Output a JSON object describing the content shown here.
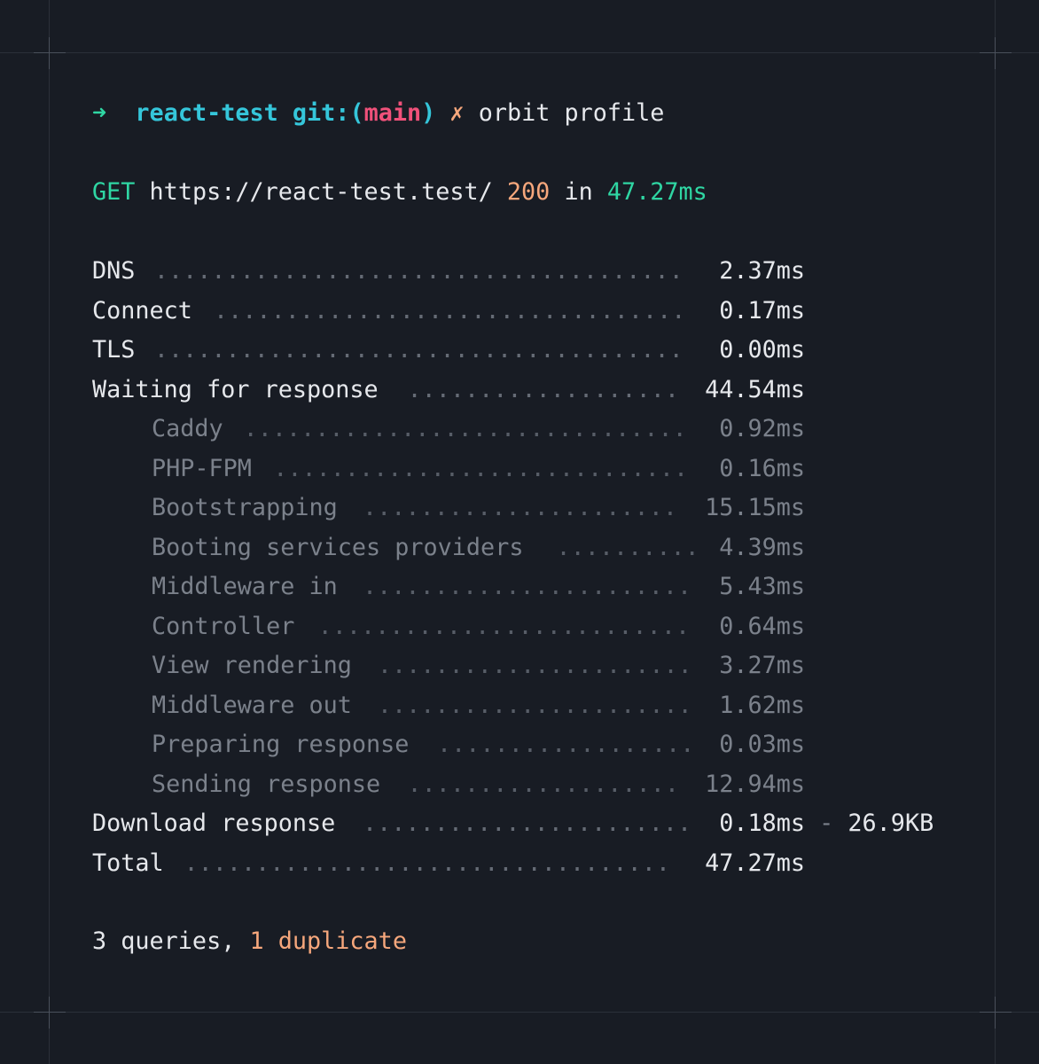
{
  "prompt": {
    "arrow": "➜",
    "directory": "react-test",
    "git_label": "git:(",
    "branch": "main",
    "git_close": ")",
    "dirty_mark": "✗",
    "command": "orbit profile"
  },
  "request": {
    "method": "GET",
    "url": "https://react-test.test/",
    "status": "200",
    "in_label": "in",
    "duration": "47.27ms"
  },
  "timings": [
    {
      "label": "DNS",
      "value": "2.37ms",
      "sub": false
    },
    {
      "label": "Connect",
      "value": "0.17ms",
      "sub": false
    },
    {
      "label": "TLS",
      "value": "0.00ms",
      "sub": false
    },
    {
      "label": "Waiting for response",
      "value": "44.54ms",
      "sub": false
    },
    {
      "label": "Caddy",
      "value": "0.92ms",
      "sub": true
    },
    {
      "label": "PHP-FPM",
      "value": "0.16ms",
      "sub": true
    },
    {
      "label": "Bootstrapping",
      "value": "15.15ms",
      "sub": true
    },
    {
      "label": "Booting services providers",
      "value": "4.39ms",
      "sub": true
    },
    {
      "label": "Middleware in",
      "value": "5.43ms",
      "sub": true
    },
    {
      "label": "Controller",
      "value": "0.64ms",
      "sub": true
    },
    {
      "label": "View rendering",
      "value": "3.27ms",
      "sub": true
    },
    {
      "label": "Middleware out",
      "value": "1.62ms",
      "sub": true
    },
    {
      "label": "Preparing response",
      "value": "0.03ms",
      "sub": true
    },
    {
      "label": "Sending response",
      "value": "12.94ms",
      "sub": true
    },
    {
      "label": "Download response",
      "value": "0.18ms",
      "sub": false,
      "extra_sep": " - ",
      "extra": "26.9KB"
    },
    {
      "label": "Total",
      "value": "47.27ms",
      "sub": false
    }
  ],
  "queries": {
    "count_text": "3 queries,",
    "duplicate_text": "1 duplicate"
  }
}
